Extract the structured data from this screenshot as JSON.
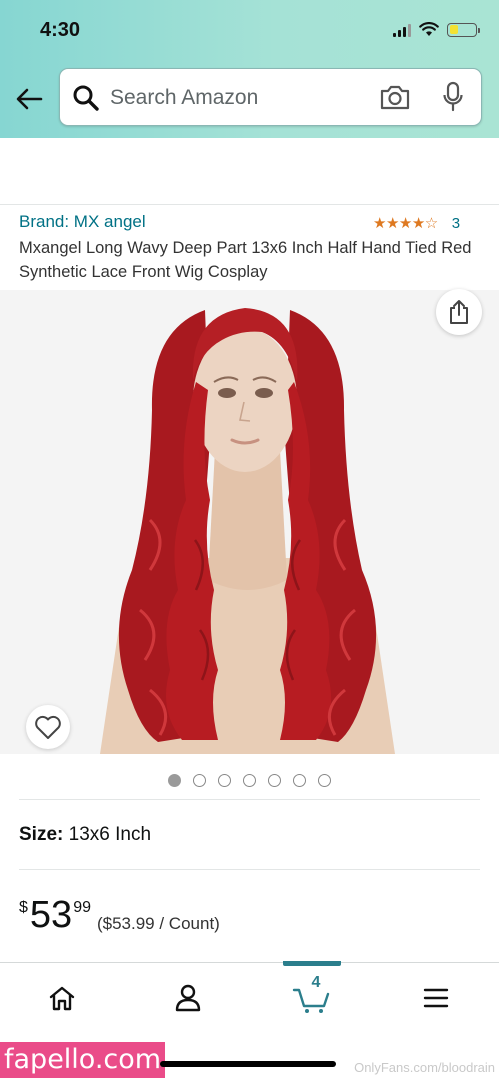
{
  "status_bar": {
    "time": "4:30"
  },
  "search": {
    "placeholder": "Search Amazon"
  },
  "product": {
    "brand": "Brand: MX angel",
    "rating_count": "3",
    "stars": "★★★★☆",
    "title": "Mxangel Long Wavy Deep Part 13x6 Inch Half Hand Tied Red Synthetic Lace Front Wig Cosplay",
    "image_count": 7,
    "active_image": 1,
    "size_label": "Size:",
    "size_value": "13x6 Inch",
    "price_symbol": "$",
    "price_whole": "53",
    "price_fraction": "99",
    "unit_price": "($53.99 / Count)"
  },
  "nav": {
    "cart_count": "4"
  },
  "watermarks": {
    "site": "fapello.com",
    "onlyfans": "OnlyFans.com/bloodrain"
  },
  "colors": {
    "header_start": "#86d6d2",
    "link": "#007185",
    "star": "#de7921",
    "active": "#2b7e8c",
    "wig": "#b31d22"
  }
}
